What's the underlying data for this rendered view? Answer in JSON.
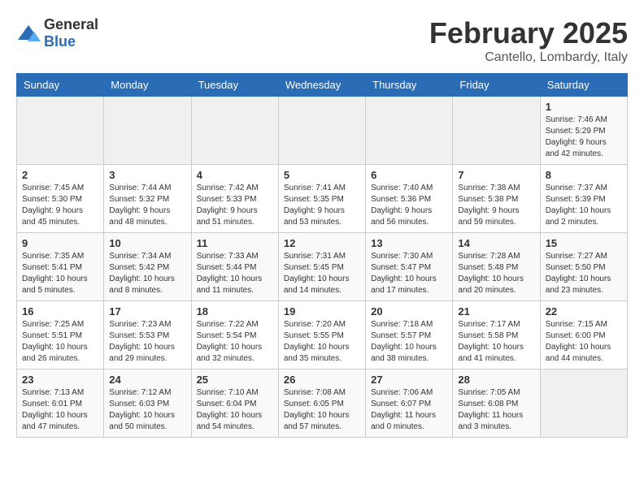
{
  "logo": {
    "general": "General",
    "blue": "Blue"
  },
  "header": {
    "month": "February 2025",
    "location": "Cantello, Lombardy, Italy"
  },
  "weekdays": [
    "Sunday",
    "Monday",
    "Tuesday",
    "Wednesday",
    "Thursday",
    "Friday",
    "Saturday"
  ],
  "weeks": [
    [
      {
        "day": "",
        "info": ""
      },
      {
        "day": "",
        "info": ""
      },
      {
        "day": "",
        "info": ""
      },
      {
        "day": "",
        "info": ""
      },
      {
        "day": "",
        "info": ""
      },
      {
        "day": "",
        "info": ""
      },
      {
        "day": "1",
        "info": "Sunrise: 7:46 AM\nSunset: 5:29 PM\nDaylight: 9 hours and 42 minutes."
      }
    ],
    [
      {
        "day": "2",
        "info": "Sunrise: 7:45 AM\nSunset: 5:30 PM\nDaylight: 9 hours and 45 minutes."
      },
      {
        "day": "3",
        "info": "Sunrise: 7:44 AM\nSunset: 5:32 PM\nDaylight: 9 hours and 48 minutes."
      },
      {
        "day": "4",
        "info": "Sunrise: 7:42 AM\nSunset: 5:33 PM\nDaylight: 9 hours and 51 minutes."
      },
      {
        "day": "5",
        "info": "Sunrise: 7:41 AM\nSunset: 5:35 PM\nDaylight: 9 hours and 53 minutes."
      },
      {
        "day": "6",
        "info": "Sunrise: 7:40 AM\nSunset: 5:36 PM\nDaylight: 9 hours and 56 minutes."
      },
      {
        "day": "7",
        "info": "Sunrise: 7:38 AM\nSunset: 5:38 PM\nDaylight: 9 hours and 59 minutes."
      },
      {
        "day": "8",
        "info": "Sunrise: 7:37 AM\nSunset: 5:39 PM\nDaylight: 10 hours and 2 minutes."
      }
    ],
    [
      {
        "day": "9",
        "info": "Sunrise: 7:35 AM\nSunset: 5:41 PM\nDaylight: 10 hours and 5 minutes."
      },
      {
        "day": "10",
        "info": "Sunrise: 7:34 AM\nSunset: 5:42 PM\nDaylight: 10 hours and 8 minutes."
      },
      {
        "day": "11",
        "info": "Sunrise: 7:33 AM\nSunset: 5:44 PM\nDaylight: 10 hours and 11 minutes."
      },
      {
        "day": "12",
        "info": "Sunrise: 7:31 AM\nSunset: 5:45 PM\nDaylight: 10 hours and 14 minutes."
      },
      {
        "day": "13",
        "info": "Sunrise: 7:30 AM\nSunset: 5:47 PM\nDaylight: 10 hours and 17 minutes."
      },
      {
        "day": "14",
        "info": "Sunrise: 7:28 AM\nSunset: 5:48 PM\nDaylight: 10 hours and 20 minutes."
      },
      {
        "day": "15",
        "info": "Sunrise: 7:27 AM\nSunset: 5:50 PM\nDaylight: 10 hours and 23 minutes."
      }
    ],
    [
      {
        "day": "16",
        "info": "Sunrise: 7:25 AM\nSunset: 5:51 PM\nDaylight: 10 hours and 26 minutes."
      },
      {
        "day": "17",
        "info": "Sunrise: 7:23 AM\nSunset: 5:53 PM\nDaylight: 10 hours and 29 minutes."
      },
      {
        "day": "18",
        "info": "Sunrise: 7:22 AM\nSunset: 5:54 PM\nDaylight: 10 hours and 32 minutes."
      },
      {
        "day": "19",
        "info": "Sunrise: 7:20 AM\nSunset: 5:55 PM\nDaylight: 10 hours and 35 minutes."
      },
      {
        "day": "20",
        "info": "Sunrise: 7:18 AM\nSunset: 5:57 PM\nDaylight: 10 hours and 38 minutes."
      },
      {
        "day": "21",
        "info": "Sunrise: 7:17 AM\nSunset: 5:58 PM\nDaylight: 10 hours and 41 minutes."
      },
      {
        "day": "22",
        "info": "Sunrise: 7:15 AM\nSunset: 6:00 PM\nDaylight: 10 hours and 44 minutes."
      }
    ],
    [
      {
        "day": "23",
        "info": "Sunrise: 7:13 AM\nSunset: 6:01 PM\nDaylight: 10 hours and 47 minutes."
      },
      {
        "day": "24",
        "info": "Sunrise: 7:12 AM\nSunset: 6:03 PM\nDaylight: 10 hours and 50 minutes."
      },
      {
        "day": "25",
        "info": "Sunrise: 7:10 AM\nSunset: 6:04 PM\nDaylight: 10 hours and 54 minutes."
      },
      {
        "day": "26",
        "info": "Sunrise: 7:08 AM\nSunset: 6:05 PM\nDaylight: 10 hours and 57 minutes."
      },
      {
        "day": "27",
        "info": "Sunrise: 7:06 AM\nSunset: 6:07 PM\nDaylight: 11 hours and 0 minutes."
      },
      {
        "day": "28",
        "info": "Sunrise: 7:05 AM\nSunset: 6:08 PM\nDaylight: 11 hours and 3 minutes."
      },
      {
        "day": "",
        "info": ""
      }
    ]
  ]
}
